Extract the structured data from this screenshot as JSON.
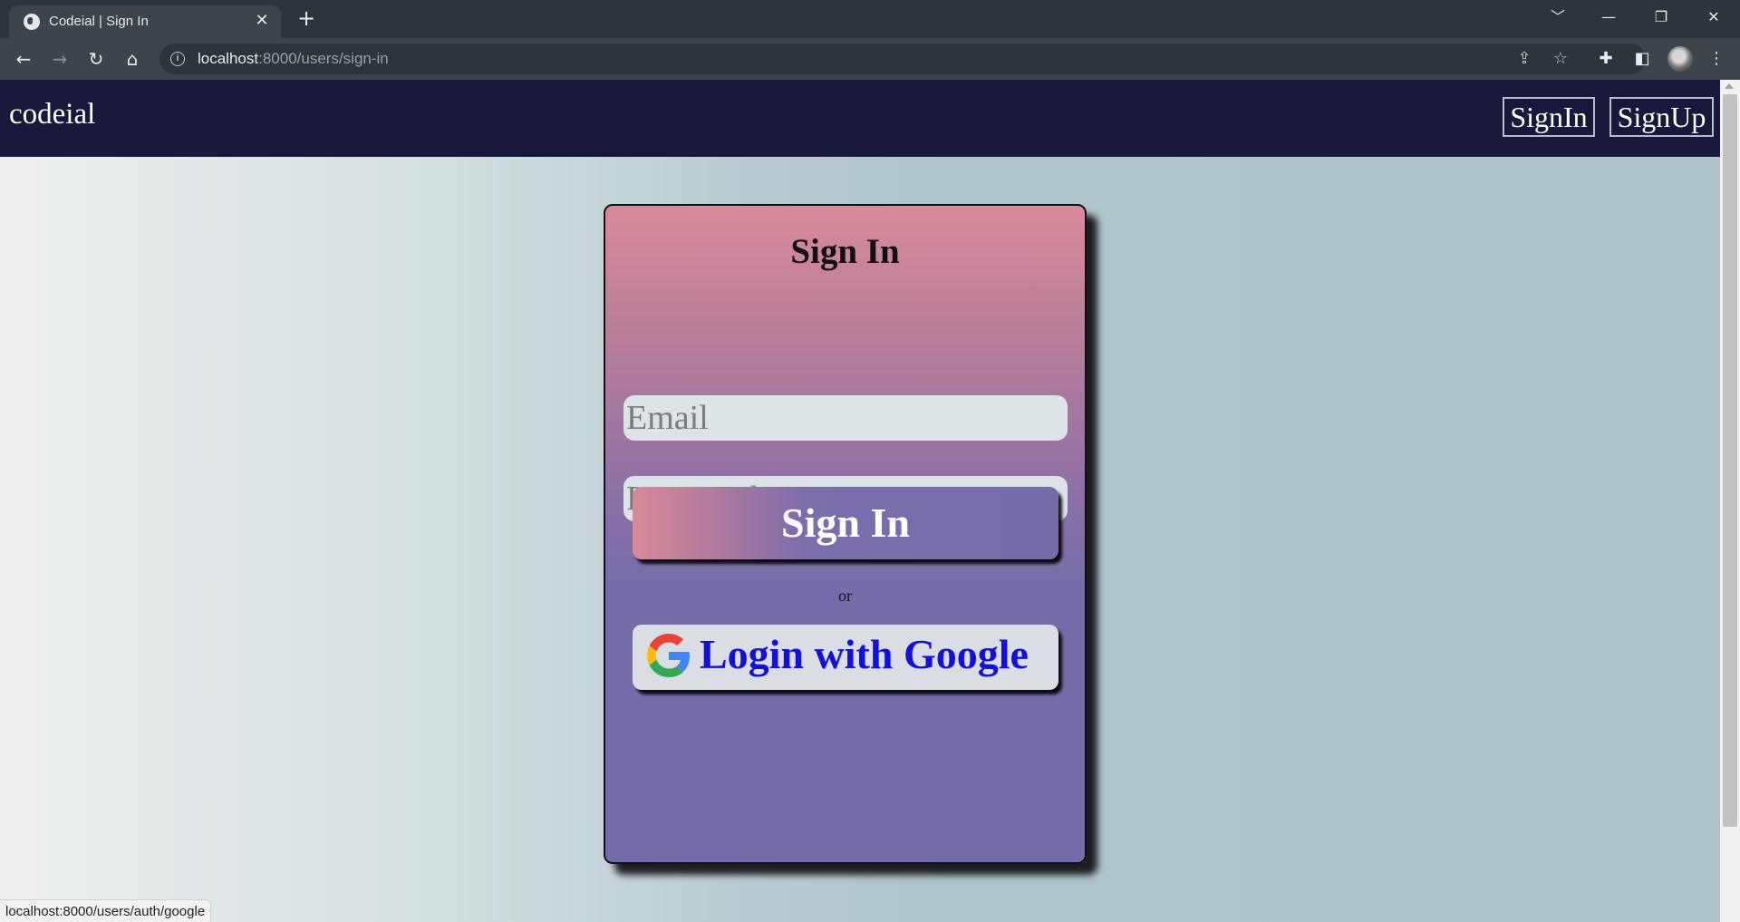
{
  "browser": {
    "tab_title": "Codeial | Sign In",
    "tab_close": "✕",
    "new_tab": "+",
    "url_host": "localhost",
    "url_path": ":8000/users/sign-in",
    "window_controls": [
      "﹀",
      "—",
      "❐",
      "✕"
    ],
    "icons": {
      "back": "back-arrow-icon",
      "forward": "forward-arrow-icon",
      "reload": "reload-icon",
      "home": "home-icon",
      "site_info": "info-icon",
      "share": "share-icon",
      "bookmark": "star-icon",
      "extensions": "puzzle-icon",
      "side_panel": "side-panel-icon",
      "menu": "kebab-menu-icon"
    },
    "glyphs": {
      "back": "←",
      "forward": "→",
      "reload": "↻",
      "home": "⌂",
      "info": "i",
      "share": "⇪",
      "star": "☆",
      "extensions": "✚",
      "side_panel": "◧",
      "menu": "⋮"
    },
    "status_url": "localhost:8000/users/auth/google"
  },
  "header": {
    "brand": "codeial",
    "signin_label": "SignIn",
    "signup_label": "SignUp"
  },
  "form": {
    "title": "Sign In",
    "email_placeholder": "Email",
    "password_placeholder": "Password",
    "submit_label": "Sign In",
    "separator": "or",
    "google_label": "Login with Google"
  },
  "colors": {
    "header_bg": "#17183a",
    "card_top": "#d88a99",
    "card_bottom": "#756cab",
    "google_text": "#1010e0"
  }
}
